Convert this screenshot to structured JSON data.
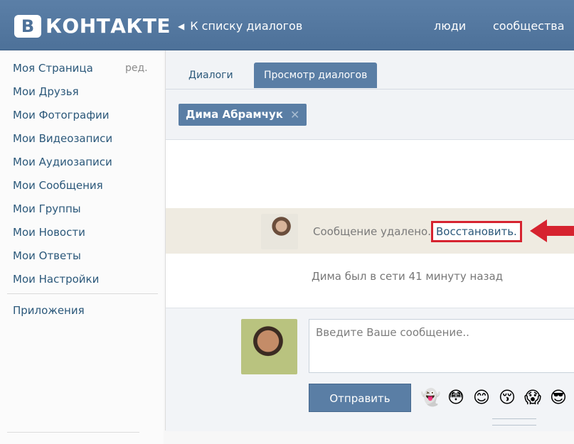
{
  "header": {
    "logo_letter": "В",
    "logo_text": "КОНТАКТЕ",
    "back_label": "К списку диалогов",
    "nav": [
      "люди",
      "сообщества"
    ]
  },
  "sidebar": {
    "items": [
      {
        "label": "Моя Страница",
        "edit": "ред."
      },
      {
        "label": "Мои Друзья"
      },
      {
        "label": "Мои Фотографии"
      },
      {
        "label": "Мои Видеозаписи"
      },
      {
        "label": "Мои Аудиозаписи"
      },
      {
        "label": "Мои Сообщения"
      },
      {
        "label": "Мои Группы"
      },
      {
        "label": "Мои Новости"
      },
      {
        "label": "Мои Ответы"
      },
      {
        "label": "Мои Настройки"
      }
    ],
    "apps": "Приложения"
  },
  "main": {
    "tabs": [
      {
        "label": "Диалоги",
        "active": false
      },
      {
        "label": "Просмотр диалогов",
        "active": true
      }
    ],
    "chip": {
      "name": "Дима Абрамчук",
      "close": "✕"
    },
    "deleted_message": {
      "text": "Сообщение удалено.",
      "restore": "Восстановить."
    },
    "online_status": "Дима был в сети 41 минуту назад",
    "compose": {
      "placeholder": "Введите Ваше сообщение..",
      "send": "Отправить",
      "emojis": [
        "👻",
        "😳",
        "😊",
        "😚",
        "😱",
        "😎",
        "😊"
      ]
    }
  },
  "colors": {
    "header": "#4d7199",
    "accent": "#5a7ea5",
    "link": "#2b587a",
    "highlight": "#d6232f",
    "deleted_row": "#efebe1"
  }
}
